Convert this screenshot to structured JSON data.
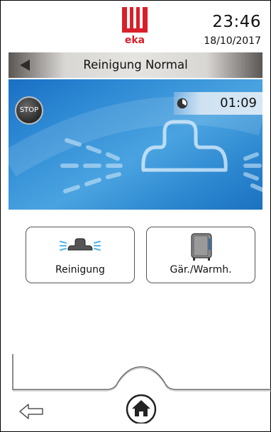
{
  "header": {
    "logo_text": "eka",
    "time": "23:46",
    "date": "18/10/2017"
  },
  "titlebar": {
    "title": "Reinigung Normal",
    "back_icon": "triangle-left-icon"
  },
  "panel": {
    "stop_label": "STOP",
    "timer_icon": "clock-icon",
    "timer_value": "01:09"
  },
  "programs": [
    {
      "label": "Reinigung",
      "icon": "cleaning-spray-icon"
    },
    {
      "label": "Gär./Warmh.",
      "icon": "cabinet-icon"
    }
  ],
  "footer": {
    "back_icon": "arrow-left-icon",
    "home_icon": "home-icon"
  },
  "colors": {
    "logo_red": "#d8202a",
    "panel_blue": "#2e8ad4",
    "spray_blue": "#4db4e6"
  }
}
